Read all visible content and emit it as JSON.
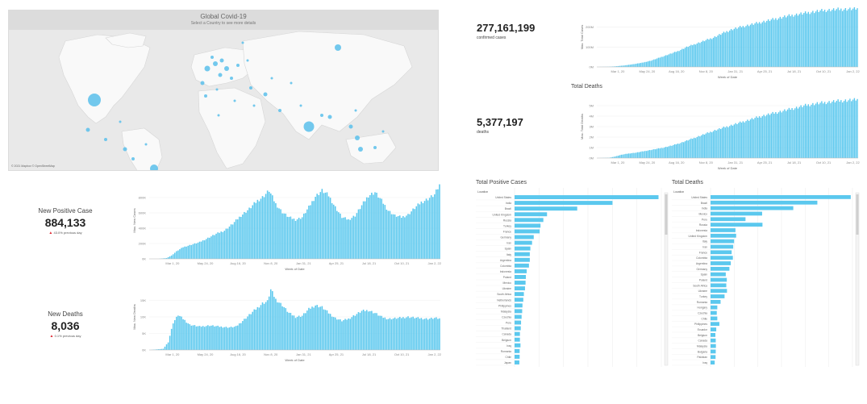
{
  "map": {
    "title": "Global Covid-19",
    "subtitle": "Select a Country to see more details",
    "attribution": "© 2021 Mapbox © OpenStreetMap",
    "bubble_color": "#5bc0eb"
  },
  "kpis": {
    "confirmed": {
      "value": "277,161,199",
      "label": "confirmed cases"
    },
    "deaths": {
      "value": "5,377,197",
      "label": "deaths"
    },
    "new_positive": {
      "title": "New Positive Case",
      "value": "884,133",
      "change": "43.0% previous day"
    },
    "new_deaths": {
      "title": "New Deaths",
      "value": "8,036",
      "change": "0.1% previous day"
    }
  },
  "colors": {
    "bar": "#5bc8ee",
    "bar_dark": "#3aaedc",
    "axis": "#bbbbbb",
    "arrow_up": "#e0303a"
  },
  "chart_data": [
    {
      "id": "new-positive-cases",
      "type": "bar",
      "title": "",
      "xlabel": "Week of Date",
      "ylabel": "Max. New Cases",
      "x_ticks": [
        "Mar 1, 20",
        "May 24, 20",
        "Aug 16, 20",
        "Nov 8, 20",
        "Jan 31, 21",
        "Apr 25, 21",
        "Jul 18, 21",
        "Oct 10, 21",
        "Jan 2, 22"
      ],
      "y_ticks": [
        "0K",
        "200K",
        "400K",
        "600K",
        "800K"
      ],
      "ylim": [
        0,
        920000
      ],
      "points": [
        [
          0,
          0
        ],
        [
          5,
          0
        ],
        [
          10,
          10000
        ],
        [
          13,
          40000
        ],
        [
          16,
          90000
        ],
        [
          20,
          140000
        ],
        [
          25,
          170000
        ],
        [
          30,
          200000
        ],
        [
          35,
          250000
        ],
        [
          40,
          300000
        ],
        [
          45,
          340000
        ],
        [
          50,
          420000
        ],
        [
          55,
          520000
        ],
        [
          60,
          600000
        ],
        [
          65,
          700000
        ],
        [
          68,
          740000
        ],
        [
          72,
          820000
        ],
        [
          76,
          660000
        ],
        [
          80,
          560000
        ],
        [
          84,
          500000
        ],
        [
          88,
          470000
        ],
        [
          92,
          500000
        ],
        [
          96,
          620000
        ],
        [
          100,
          750000
        ],
        [
          104,
          820000
        ],
        [
          108,
          760000
        ],
        [
          112,
          620000
        ],
        [
          116,
          500000
        ],
        [
          120,
          470000
        ],
        [
          124,
          520000
        ],
        [
          128,
          640000
        ],
        [
          132,
          760000
        ],
        [
          136,
          800000
        ],
        [
          140,
          700000
        ],
        [
          144,
          580000
        ],
        [
          148,
          520000
        ],
        [
          152,
          500000
        ],
        [
          156,
          530000
        ],
        [
          160,
          610000
        ],
        [
          164,
          680000
        ],
        [
          168,
          720000
        ],
        [
          172,
          770000
        ],
        [
          175,
          884133
        ]
      ],
      "n_bars": 176
    },
    {
      "id": "new-deaths",
      "type": "bar",
      "title": "",
      "xlabel": "Week of Date",
      "ylabel": "Max. New Deaths",
      "x_ticks": [
        "Mar 1, 20",
        "May 24, 20",
        "Aug 16, 20",
        "Nov 8, 20",
        "Jan 31, 21",
        "Apr 25, 21",
        "Jul 18, 21",
        "Oct 10, 21",
        "Jan 2, 22"
      ],
      "y_ticks": [
        "0K",
        "5K",
        "10K",
        "15K"
      ],
      "ylim": [
        0,
        17000
      ],
      "points": [
        [
          0,
          0
        ],
        [
          8,
          300
        ],
        [
          11,
          2000
        ],
        [
          14,
          7000
        ],
        [
          17,
          9000
        ],
        [
          20,
          8000
        ],
        [
          24,
          6500
        ],
        [
          30,
          6000
        ],
        [
          36,
          6300
        ],
        [
          42,
          6000
        ],
        [
          48,
          5800
        ],
        [
          52,
          6000
        ],
        [
          56,
          7500
        ],
        [
          60,
          9000
        ],
        [
          64,
          10500
        ],
        [
          68,
          12000
        ],
        [
          71,
          12500
        ],
        [
          73,
          15500
        ],
        [
          76,
          13000
        ],
        [
          80,
          11500
        ],
        [
          84,
          9500
        ],
        [
          88,
          8500
        ],
        [
          92,
          8800
        ],
        [
          96,
          10500
        ],
        [
          100,
          11500
        ],
        [
          104,
          11000
        ],
        [
          108,
          9500
        ],
        [
          112,
          8200
        ],
        [
          116,
          7500
        ],
        [
          120,
          8000
        ],
        [
          124,
          9000
        ],
        [
          128,
          10000
        ],
        [
          132,
          10200
        ],
        [
          136,
          9500
        ],
        [
          140,
          8500
        ],
        [
          144,
          8000
        ],
        [
          150,
          8200
        ],
        [
          156,
          8500
        ],
        [
          162,
          8200
        ],
        [
          168,
          8000
        ],
        [
          172,
          8200
        ],
        [
          175,
          8036
        ]
      ],
      "n_bars": 176
    },
    {
      "id": "total-cases",
      "type": "bar",
      "title": "",
      "xlabel": "Week of Date",
      "ylabel": "Max. Total Cases",
      "x_ticks": [
        "Mar 1, 20",
        "May 24, 20",
        "Aug 16, 20",
        "Nov 8, 20",
        "Jan 31, 21",
        "Apr 25, 21",
        "Jul 18, 21",
        "Oct 10, 21",
        "Jan 2, 22"
      ],
      "y_ticks": [
        "0M",
        "100M",
        "200M"
      ],
      "ylim": [
        0,
        285000000
      ],
      "points": [
        [
          0,
          0
        ],
        [
          8,
          1000000
        ],
        [
          12,
          3000000
        ],
        [
          18,
          7000000
        ],
        [
          24,
          13000000
        ],
        [
          30,
          20000000
        ],
        [
          36,
          30000000
        ],
        [
          42,
          45000000
        ],
        [
          48,
          60000000
        ],
        [
          54,
          75000000
        ],
        [
          60,
          95000000
        ],
        [
          66,
          110000000
        ],
        [
          72,
          125000000
        ],
        [
          78,
          140000000
        ],
        [
          84,
          160000000
        ],
        [
          90,
          178000000
        ],
        [
          96,
          190000000
        ],
        [
          102,
          200000000
        ],
        [
          108,
          210000000
        ],
        [
          114,
          220000000
        ],
        [
          120,
          230000000
        ],
        [
          126,
          240000000
        ],
        [
          132,
          248000000
        ],
        [
          138,
          255000000
        ],
        [
          144,
          262000000
        ],
        [
          150,
          268000000
        ],
        [
          156,
          272000000
        ],
        [
          162,
          275000000
        ],
        [
          168,
          276000000
        ],
        [
          175,
          277161199
        ]
      ],
      "n_bars": 176
    },
    {
      "id": "total-deaths",
      "type": "bar",
      "title": "Total Deaths",
      "xlabel": "Week of Date",
      "ylabel": "Max. Total Deaths",
      "x_ticks": [
        "Mar 1, 20",
        "May 24, 20",
        "Aug 16, 20",
        "Nov 8, 20",
        "Jan 31, 21",
        "Apr 25, 21",
        "Jul 18, 21",
        "Oct 10, 21",
        "Jan 2, 22"
      ],
      "y_ticks": [
        "0M",
        "1M",
        "2M",
        "3M",
        "4M",
        "5M"
      ],
      "ylim": [
        0,
        5800000
      ],
      "points": [
        [
          0,
          0
        ],
        [
          8,
          30000
        ],
        [
          12,
          150000
        ],
        [
          16,
          300000
        ],
        [
          20,
          400000
        ],
        [
          26,
          500000
        ],
        [
          32,
          650000
        ],
        [
          38,
          800000
        ],
        [
          44,
          950000
        ],
        [
          50,
          1150000
        ],
        [
          56,
          1400000
        ],
        [
          62,
          1700000
        ],
        [
          68,
          2000000
        ],
        [
          74,
          2300000
        ],
        [
          80,
          2600000
        ],
        [
          86,
          2850000
        ],
        [
          92,
          3100000
        ],
        [
          98,
          3350000
        ],
        [
          104,
          3600000
        ],
        [
          110,
          3850000
        ],
        [
          116,
          4050000
        ],
        [
          122,
          4250000
        ],
        [
          128,
          4450000
        ],
        [
          134,
          4650000
        ],
        [
          140,
          4850000
        ],
        [
          146,
          5000000
        ],
        [
          152,
          5100000
        ],
        [
          158,
          5200000
        ],
        [
          164,
          5280000
        ],
        [
          170,
          5340000
        ],
        [
          175,
          5377197
        ]
      ],
      "n_bars": 176
    },
    {
      "id": "total-positive-by-country",
      "type": "bar",
      "orientation": "horizontal",
      "title": "Total Positive Cases",
      "header": "Location",
      "categories": [
        "United States",
        "India",
        "Brazil",
        "United Kingdom",
        "Russia",
        "Turkey",
        "France",
        "Germany",
        "Iran",
        "Spain",
        "Italy",
        "Argentina",
        "Colombia",
        "Indonesia",
        "Poland",
        "Mexico",
        "Ukraine",
        "South Africa",
        "Netherlands",
        "Philippines",
        "Malaysia",
        "Czechia",
        "Peru",
        "Thailand",
        "Canada",
        "Belgium",
        "Iraq",
        "Romania",
        "Chile",
        "Japan"
      ],
      "values": [
        51000000,
        34700000,
        22200000,
        11500000,
        10200000,
        9200000,
        8900000,
        6800000,
        6200000,
        5600000,
        5400000,
        5400000,
        5100000,
        4300000,
        4000000,
        3900000,
        3700000,
        3300000,
        3100000,
        2800000,
        2700000,
        2500000,
        2300000,
        2200000,
        1900000,
        1900000,
        2100000,
        1800000,
        1800000,
        1700000
      ],
      "xlim": [
        0,
        52000000
      ]
    },
    {
      "id": "total-deaths-by-country",
      "type": "bar",
      "orientation": "horizontal",
      "title": "Total Deaths",
      "header": "Location",
      "categories": [
        "United States",
        "Brazil",
        "India",
        "Mexico",
        "Peru",
        "Russia",
        "Indonesia",
        "United Kingdom",
        "Italy",
        "Iran",
        "France",
        "Colombia",
        "Argentina",
        "Germany",
        "Spain",
        "Poland",
        "South Africa",
        "Ukraine",
        "Turkey",
        "Romania",
        "Hungary",
        "Czechia",
        "Chile",
        "Philippines",
        "Ecuador",
        "Belgium",
        "Canada",
        "Malaysia",
        "Bulgaria",
        "Pakistan",
        "Iraq"
      ],
      "values": [
        810000,
        617000,
        478000,
        298000,
        202000,
        300000,
        144000,
        148000,
        136000,
        131000,
        122000,
        129000,
        117000,
        109000,
        88000,
        94000,
        91000,
        95000,
        81000,
        58000,
        39000,
        36000,
        39000,
        51000,
        33000,
        28000,
        30000,
        31000,
        30000,
        29000,
        24000
      ],
      "xlim": [
        0,
        820000
      ]
    }
  ]
}
